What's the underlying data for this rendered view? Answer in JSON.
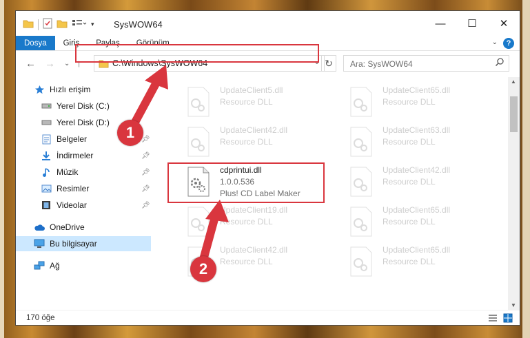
{
  "window": {
    "title": "SysWOW64"
  },
  "ribbon": {
    "tabs": [
      "Dosya",
      "Giriş",
      "Paylaş",
      "Görünüm"
    ],
    "help": "?"
  },
  "address": {
    "path": "C:\\Windows\\SysWOW64"
  },
  "search": {
    "placeholder": "Ara: SysWOW64"
  },
  "sidebar": {
    "quick_access": "Hızlı erişim",
    "items": [
      {
        "label": "Yerel Disk (C:)",
        "icon": "drive-icon"
      },
      {
        "label": "Yerel Disk (D:)",
        "icon": "drive-icon"
      },
      {
        "label": "Belgeler",
        "icon": "documents-icon"
      },
      {
        "label": "İndirmeler",
        "icon": "download-icon"
      },
      {
        "label": "Müzik",
        "icon": "music-icon"
      },
      {
        "label": "Resimler",
        "icon": "pictures-icon"
      },
      {
        "label": "Videolar",
        "icon": "videos-icon"
      }
    ],
    "onedrive": "OneDrive",
    "this_pc": "Bu bilgisayar",
    "network": "Ağ"
  },
  "files": {
    "highlighted": {
      "name": "cdprintui.dll",
      "version": "1.0.0.536",
      "description": "Plus! CD Label Maker"
    },
    "background": [
      {
        "name": "UpdateClient5.dll",
        "type": "Resource DLL"
      },
      {
        "name": "UpdateClient65.dll",
        "type": "Resource DLL"
      },
      {
        "name": "UpdateClient42.dll",
        "type": "Resource DLL"
      },
      {
        "name": "UpdateClient63.dll",
        "type": "Resource DLL"
      },
      {
        "name": "UpdateClient42.dll",
        "type": "Resource DLL"
      },
      {
        "name": "UpdateClient19.dll",
        "type": "Resource DLL"
      },
      {
        "name": "UpdateClient65.dll",
        "type": "Resource DLL"
      },
      {
        "name": "UpdateClient42.dll",
        "type": "Resource DLL"
      },
      {
        "name": "UpdateClient65.dll",
        "type": "Resource DLL"
      }
    ]
  },
  "status": {
    "count": "170 öğe"
  },
  "annotations": {
    "step1": "1",
    "step2": "2"
  },
  "colors": {
    "accent": "#1979ca",
    "annotation": "#d9363e",
    "selected": "#cce8ff"
  }
}
